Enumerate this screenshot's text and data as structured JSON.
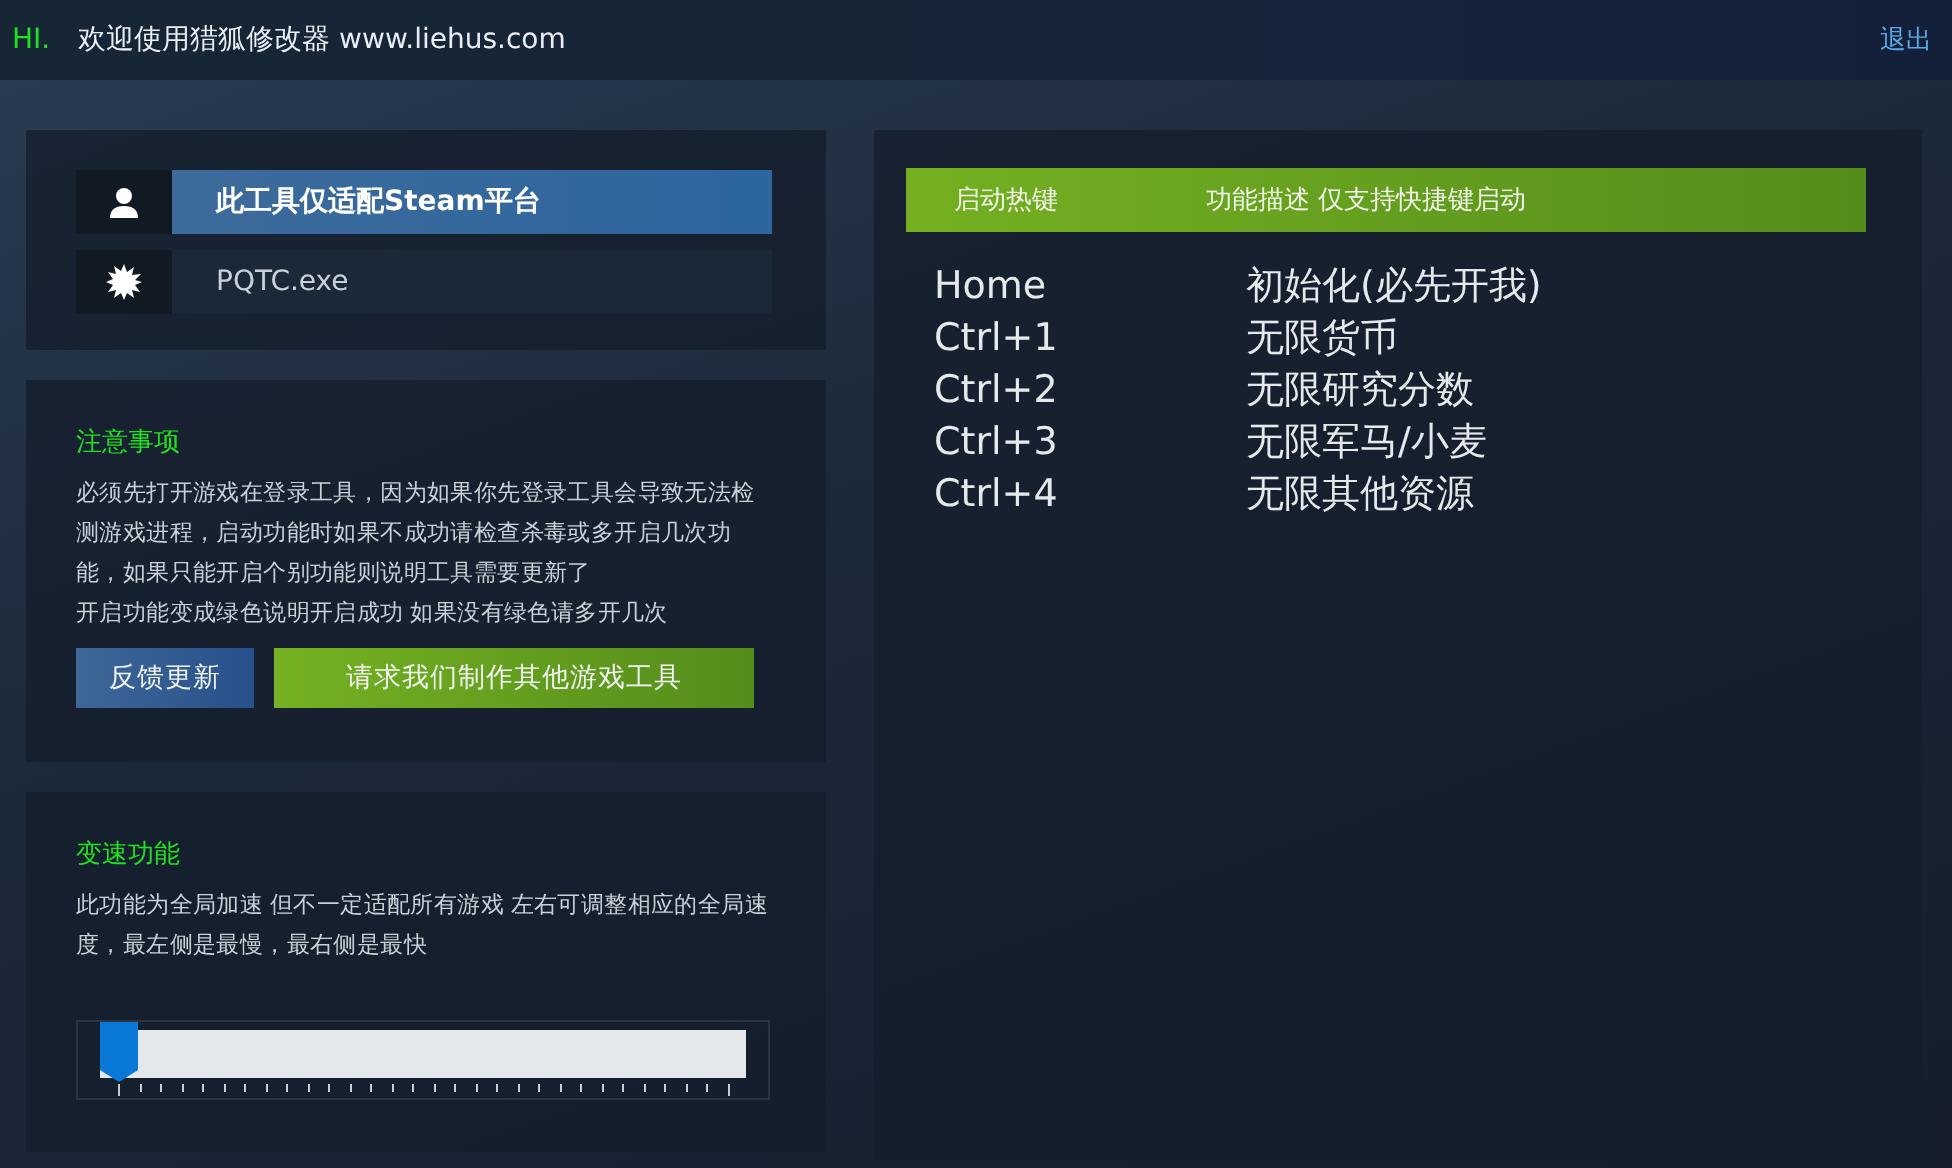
{
  "header": {
    "greeting": "HI.",
    "title": "欢迎使用猎狐修改器 www.liehus.com",
    "logout": "退出"
  },
  "info": {
    "platform": "此工具仅适配Steam平台",
    "process": "PQTC.exe"
  },
  "notice": {
    "title": "注意事项",
    "text": "必须先打开游戏在登录工具，因为如果你先登录工具会导致无法检测游戏进程，启动功能时如果不成功请检查杀毒或多开启几次功能，如果只能开启个别功能则说明工具需要更新了",
    "text2": "开启功能变成绿色说明开启成功 如果没有绿色请多开几次",
    "buttons": [
      {
        "label": "反馈更新",
        "kind": "blue"
      },
      {
        "label": "请求我们制作其他游戏工具",
        "kind": "green"
      }
    ]
  },
  "speed": {
    "title": "变速功能",
    "text": "此功能为全局加速 但不一定适配所有游戏 左右可调整相应的全局速度，最左侧是最慢，最右侧是最快",
    "level": 0
  },
  "hotkeys": {
    "columns": [
      "启动热键",
      "功能描述 仅支持快捷键启动"
    ],
    "rows": [
      {
        "key": "Home",
        "action": "初始化(必先开我)"
      },
      {
        "key": "Ctrl+1",
        "action": "无限货币"
      },
      {
        "key": "Ctrl+2",
        "action": "无限研究分数"
      },
      {
        "key": "Ctrl+3",
        "action": "无限军马/小麦"
      },
      {
        "key": "Ctrl+4",
        "action": "无限其他资源"
      }
    ]
  }
}
